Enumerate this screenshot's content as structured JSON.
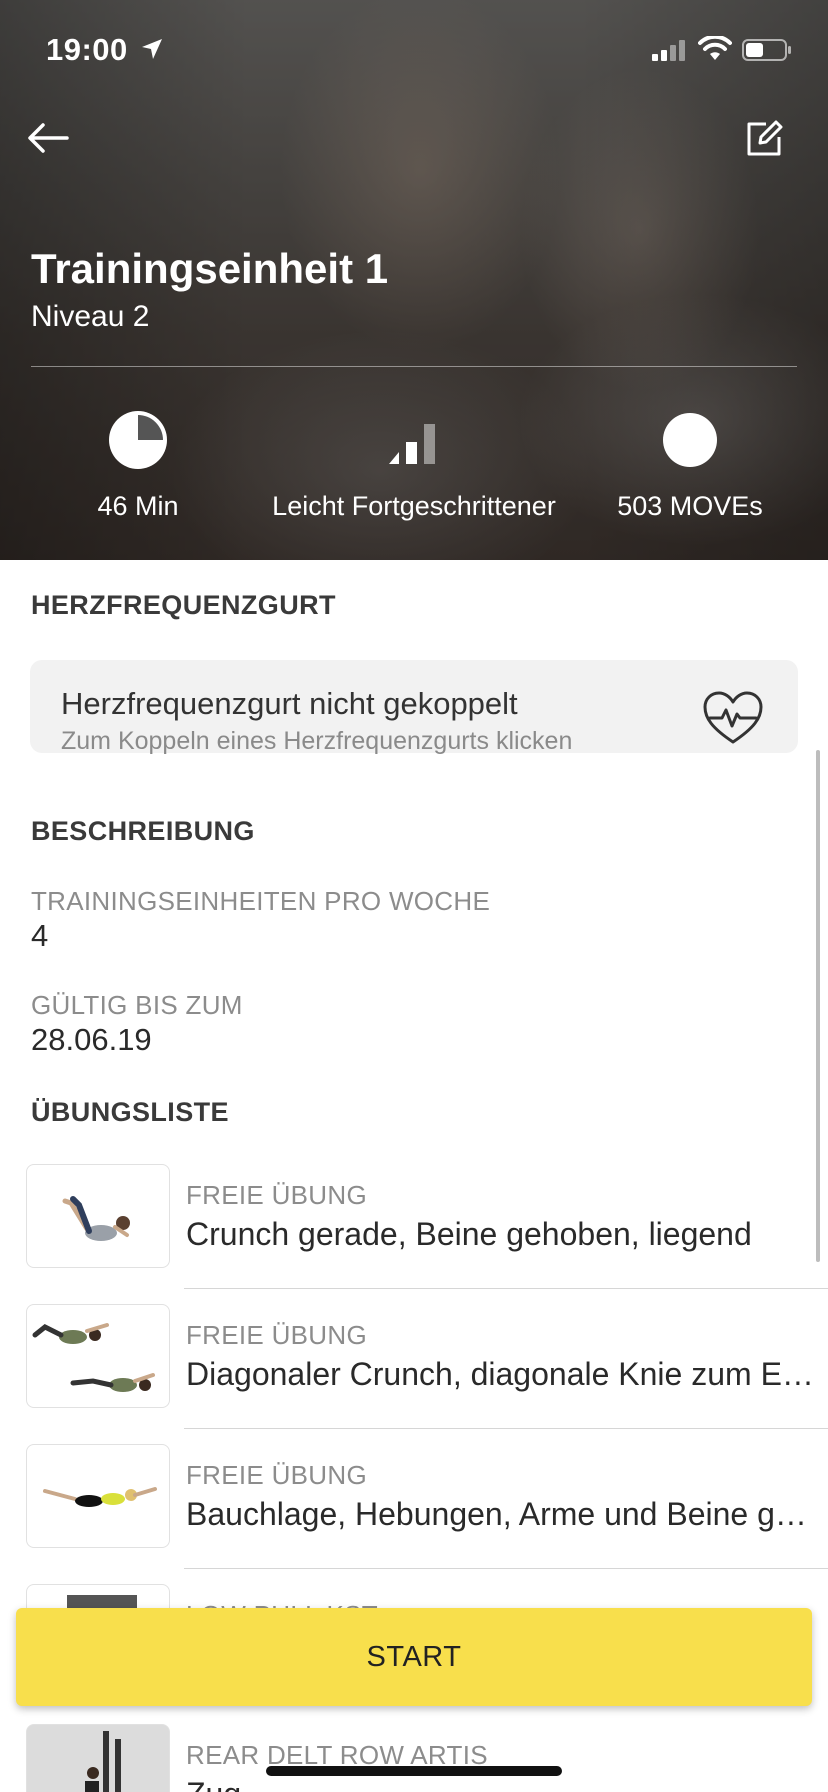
{
  "status_bar": {
    "time": "19:00"
  },
  "header": {
    "title": "Trainingseinheit 1",
    "subtitle": "Niveau 2"
  },
  "stats": [
    {
      "icon": "clock-pie-icon",
      "label": "46 Min"
    },
    {
      "icon": "level-bars-icon",
      "label": "Leicht Fortgeschrittener"
    },
    {
      "icon": "moves-circle-icon",
      "label": "503 MOVEs"
    }
  ],
  "heart_rate": {
    "heading": "HERZFREQUENZGURT",
    "title": "Herzfrequenzgurt nicht gekoppelt",
    "hint": "Zum Koppeln eines Herzfrequenzgurts klicken"
  },
  "description": {
    "heading": "BESCHREIBUNG",
    "fields": [
      {
        "label": "TRAININGSEINHEITEN PRO WOCHE",
        "value": "4"
      },
      {
        "label": "GÜLTIG BIS ZUM",
        "value": "28.06.19"
      }
    ]
  },
  "exercises": {
    "heading": "ÜBUNGSLISTE",
    "items": [
      {
        "category": "FREIE ÜBUNG",
        "name": "Crunch gerade, Beine gehoben, liegend"
      },
      {
        "category": "FREIE ÜBUNG",
        "name": "Diagonaler Crunch, diagonale Knie zum Ellbogen"
      },
      {
        "category": "FREIE ÜBUNG",
        "name": "Bauchlage, Hebungen, Arme und Beine gestreckt"
      },
      {
        "category": "LOW PULL KST",
        "name": ""
      },
      {
        "category": "REAR DELT ROW ARTIS",
        "name": "Zug"
      }
    ]
  },
  "actions": {
    "start": "START"
  },
  "colors": {
    "accent": "#f8df4c",
    "card": "#f2f2f2"
  }
}
